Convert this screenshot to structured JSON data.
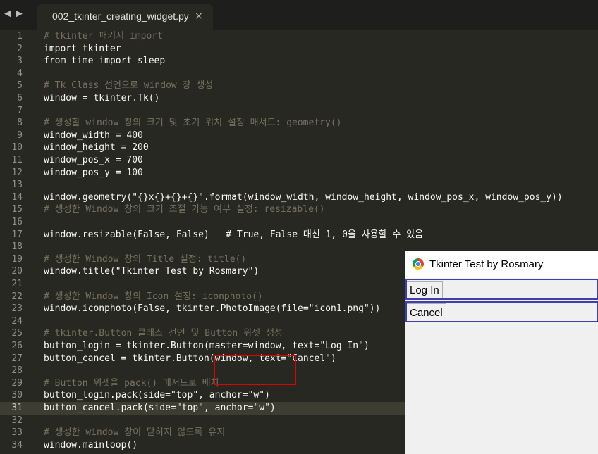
{
  "tab": {
    "title": "002_tkinter_creating_widget.py",
    "close": "×"
  },
  "nav": {
    "back": "◀",
    "forward": "▶"
  },
  "code_lines": [
    {
      "n": "1",
      "t": "# tkinter 패키지 import"
    },
    {
      "n": "2",
      "t": "import tkinter"
    },
    {
      "n": "3",
      "t": "from time import sleep"
    },
    {
      "n": "4",
      "t": ""
    },
    {
      "n": "5",
      "t": "# Tk Class 선언으로 window 창 생성"
    },
    {
      "n": "6",
      "t": "window = tkinter.Tk()"
    },
    {
      "n": "7",
      "t": ""
    },
    {
      "n": "8",
      "t": "# 생성할 window 창의 크기 및 초기 위치 설정 매서드: geometry()"
    },
    {
      "n": "9",
      "t": "window_width = 400"
    },
    {
      "n": "10",
      "t": "window_height = 200"
    },
    {
      "n": "11",
      "t": "window_pos_x = 700"
    },
    {
      "n": "12",
      "t": "window_pos_y = 100"
    },
    {
      "n": "13",
      "t": ""
    },
    {
      "n": "14",
      "t": "window.geometry(\"{}x{}+{}+{}\".format(window_width, window_height, window_pos_x, window_pos_y))"
    },
    {
      "n": "15",
      "t": "# 생성한 Window 창의 크기 조절 가능 여부 설정: resizable()"
    },
    {
      "n": "16",
      "t": ""
    },
    {
      "n": "17",
      "t": "window.resizable(False, False)   # True, False 대신 1, 0을 사용할 수 있음"
    },
    {
      "n": "18",
      "t": ""
    },
    {
      "n": "19",
      "t": "# 생성한 Window 창의 Title 설정: title()"
    },
    {
      "n": "20",
      "t": "window.title(\"Tkinter Test by Rosmary\")"
    },
    {
      "n": "21",
      "t": ""
    },
    {
      "n": "22",
      "t": "# 생성한 Window 창의 Icon 설정: iconphoto()"
    },
    {
      "n": "23",
      "t": "window.iconphoto(False, tkinter.PhotoImage(file=\"icon1.png\"))"
    },
    {
      "n": "24",
      "t": ""
    },
    {
      "n": "25",
      "t": "# tkinter.Button 클래스 선언 및 Button 위젯 생성"
    },
    {
      "n": "26",
      "t": "button_login = tkinter.Button(master=window, text=\"Log In\")"
    },
    {
      "n": "27",
      "t": "button_cancel = tkinter.Button(window, text=\"Cancel\")"
    },
    {
      "n": "28",
      "t": ""
    },
    {
      "n": "29",
      "t": "# Button 위젯을 pack() 매서드로 배치"
    },
    {
      "n": "30",
      "t": "button_login.pack(side=\"top\", anchor=\"w\")"
    },
    {
      "n": "31",
      "t": "button_cancel.pack(side=\"top\", anchor=\"w\")"
    },
    {
      "n": "32",
      "t": ""
    },
    {
      "n": "33",
      "t": "# 생성한 window 창이 닫히지 않도록 유지"
    },
    {
      "n": "34",
      "t": "window.mainloop()"
    }
  ],
  "tk_window": {
    "title": "Tkinter Test by Rosmary",
    "icon": "chrome-icon",
    "buttons": {
      "login": "Log In",
      "cancel": "Cancel"
    }
  },
  "colors": {
    "editor_bg": "#272822",
    "highlight_box": "#e00000",
    "widget_box": "#3f3fb0"
  }
}
